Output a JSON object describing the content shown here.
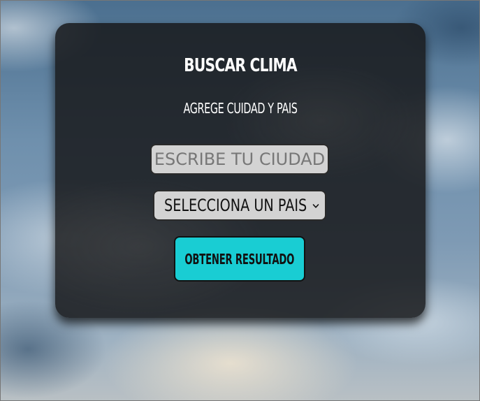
{
  "form": {
    "title": "BUSCAR CLIMA",
    "subtitle": "AGREGE CUIDAD Y PAIS",
    "city_input": {
      "placeholder": "ESCRIBE TU CIUDAD",
      "value": ""
    },
    "country_select": {
      "selected": "SELECCIONA UN PAIS",
      "icon": "chevron-down-icon"
    },
    "submit_label": "OBTENER RESULTADO"
  },
  "colors": {
    "card_background": "#181a1c",
    "button_accent": "#19cdd3",
    "field_background": "#d3d3d3",
    "text_light": "#ffffff"
  }
}
